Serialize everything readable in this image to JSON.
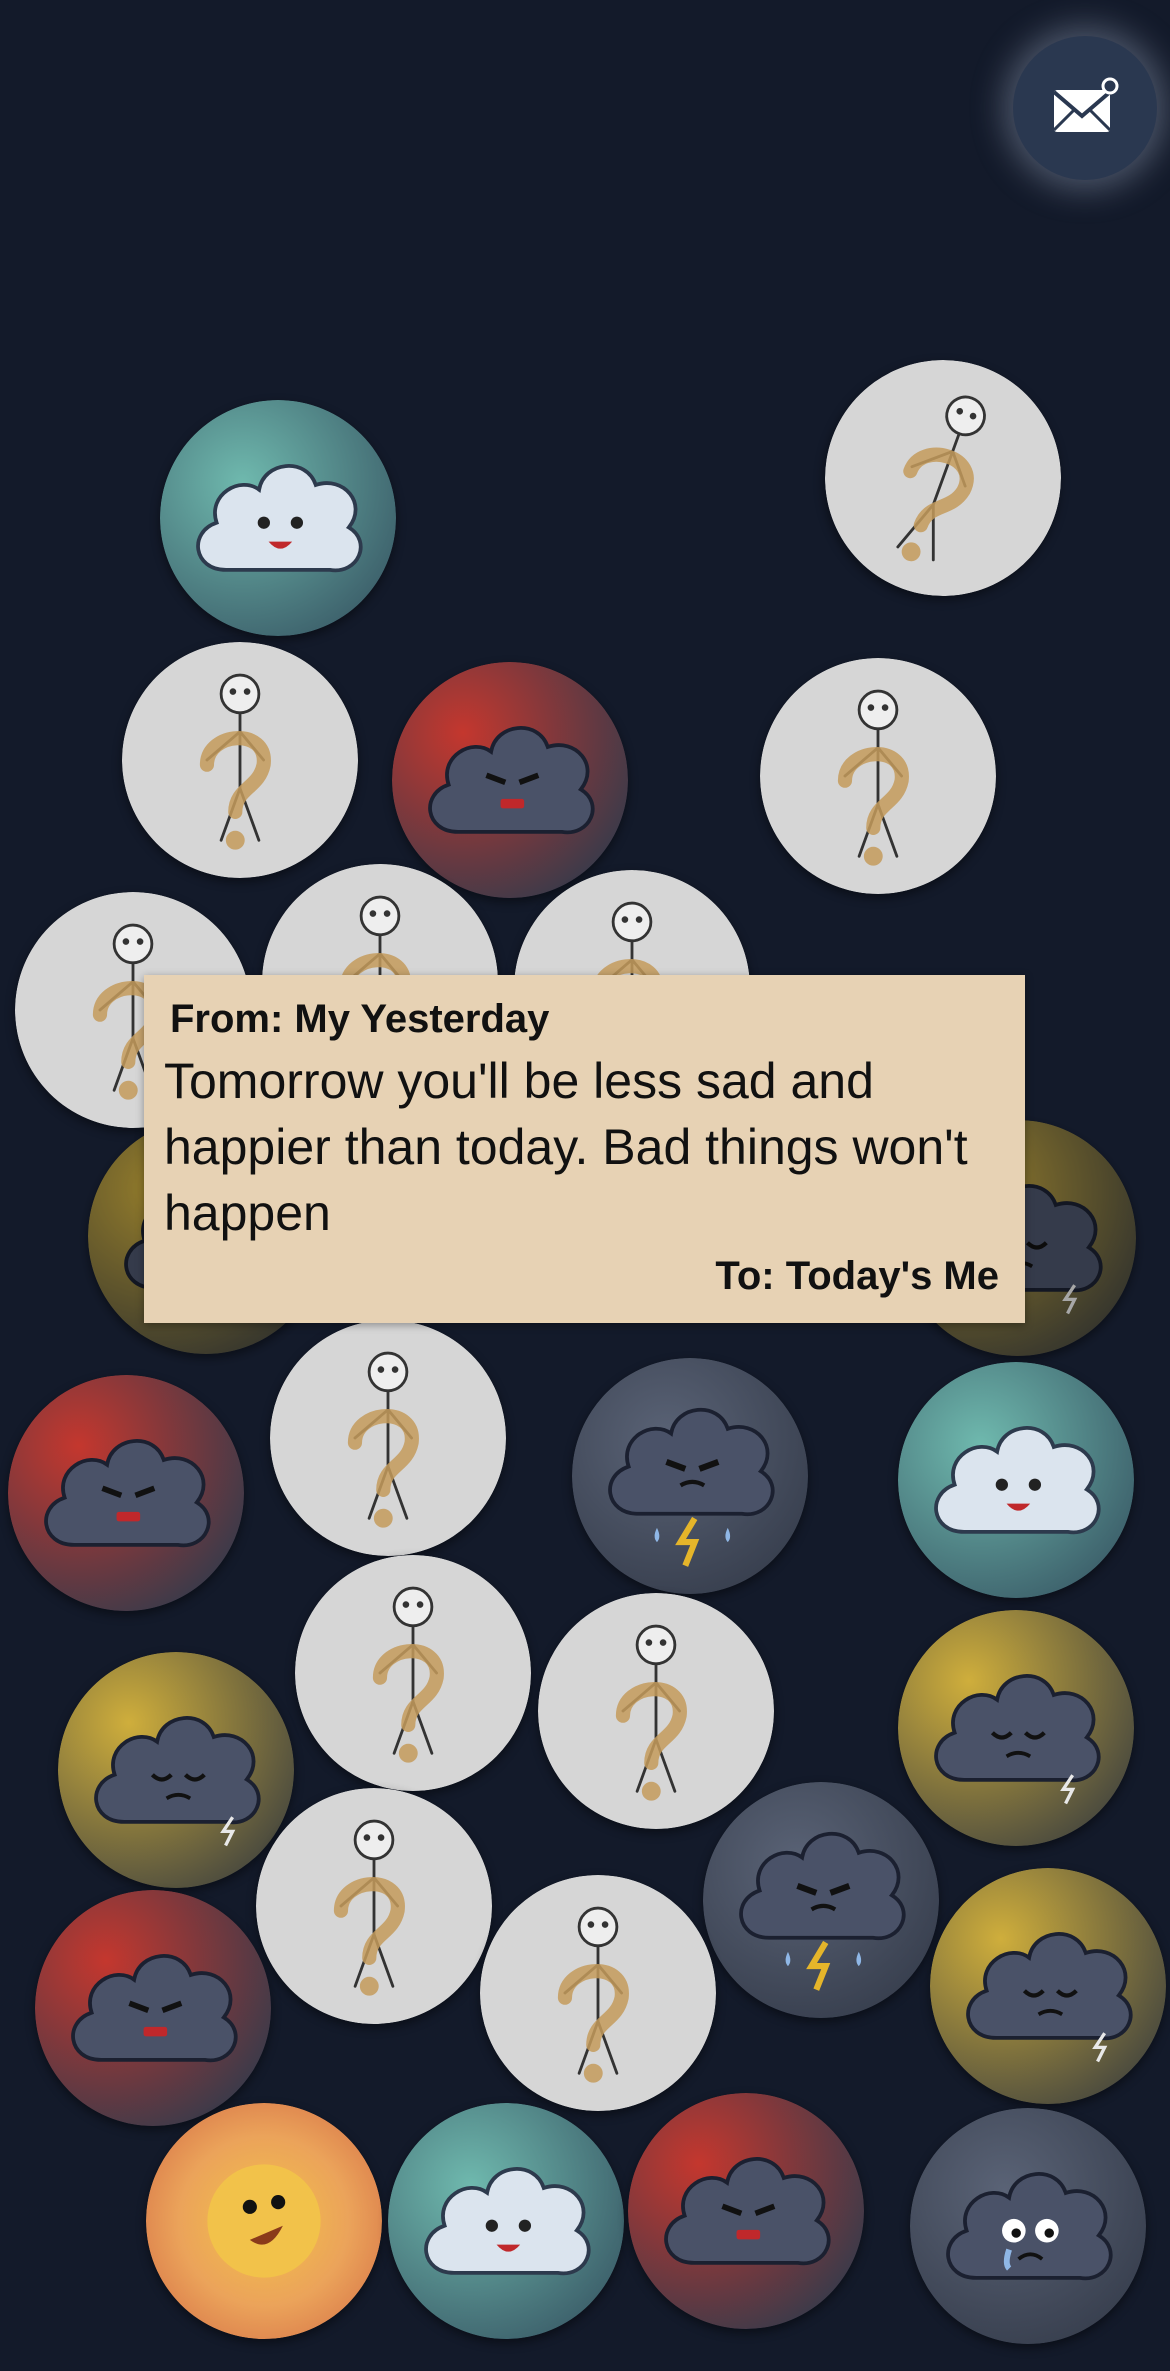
{
  "header": {
    "mail_button_icon": "envelope-notification-icon"
  },
  "note": {
    "from": "From: My Yesterday",
    "message": "Tomorrow you'll be less sad and happier than today. Bad things won't happen",
    "to": "To: Today's Me"
  },
  "bubbles": [
    {
      "type": "cloud-happy-teal",
      "icon": "happy-cloud-icon"
    },
    {
      "type": "confused-stick-figure",
      "icon": "question-mark-stick-figure-icon"
    },
    {
      "type": "confused-stick-figure",
      "icon": "question-mark-stick-figure-icon"
    },
    {
      "type": "cloud-angry-red",
      "icon": "angry-cloud-icon"
    },
    {
      "type": "confused-stick-figure",
      "icon": "question-mark-stick-figure-icon"
    },
    {
      "type": "confused-stick-figure",
      "icon": "question-mark-stick-figure-icon"
    },
    {
      "type": "confused-stick-figure",
      "icon": "question-mark-stick-figure-icon"
    },
    {
      "type": "confused-stick-figure",
      "icon": "question-mark-stick-figure-icon"
    },
    {
      "type": "cloud-tired-yellow",
      "icon": "tired-cloud-icon"
    },
    {
      "type": "cloud-storm-yellow",
      "icon": "storm-cloud-icon"
    },
    {
      "type": "cloud-angry-red",
      "icon": "angry-cloud-icon"
    },
    {
      "type": "confused-stick-figure",
      "icon": "question-mark-stick-figure-icon"
    },
    {
      "type": "cloud-thunder-gray",
      "icon": "thunder-cloud-icon"
    },
    {
      "type": "cloud-happy-teal",
      "icon": "happy-cloud-icon"
    },
    {
      "type": "cloud-tired-yellow",
      "icon": "tired-cloud-icon"
    },
    {
      "type": "confused-stick-figure",
      "icon": "question-mark-stick-figure-icon"
    },
    {
      "type": "confused-stick-figure",
      "icon": "question-mark-stick-figure-icon"
    },
    {
      "type": "cloud-tired-yellow",
      "icon": "tired-cloud-icon"
    },
    {
      "type": "confused-stick-figure",
      "icon": "question-mark-stick-figure-icon"
    },
    {
      "type": "cloud-thunder-gray",
      "icon": "thunder-cloud-icon"
    },
    {
      "type": "cloud-angry-red",
      "icon": "angry-cloud-icon"
    },
    {
      "type": "confused-stick-figure",
      "icon": "question-mark-stick-figure-icon"
    },
    {
      "type": "cloud-tired-yellow",
      "icon": "tired-cloud-icon"
    },
    {
      "type": "sun-happy",
      "icon": "happy-sun-icon"
    },
    {
      "type": "cloud-happy-teal",
      "icon": "happy-cloud-icon"
    },
    {
      "type": "cloud-angry-red",
      "icon": "angry-cloud-icon"
    },
    {
      "type": "cloud-crying-gray",
      "icon": "crying-cloud-icon"
    }
  ],
  "colors": {
    "background": "#131a2a",
    "note_paper": "#e7d2b4",
    "mail_button": "#2a3850",
    "teal": "#5aa39a",
    "red": "#b0312b",
    "yellow": "#c8a83a",
    "gray": "#4a5366",
    "stick_bg": "#d6d6d6",
    "cloud_dark": "#4a5268",
    "cloud_light": "#dbe4ee"
  }
}
